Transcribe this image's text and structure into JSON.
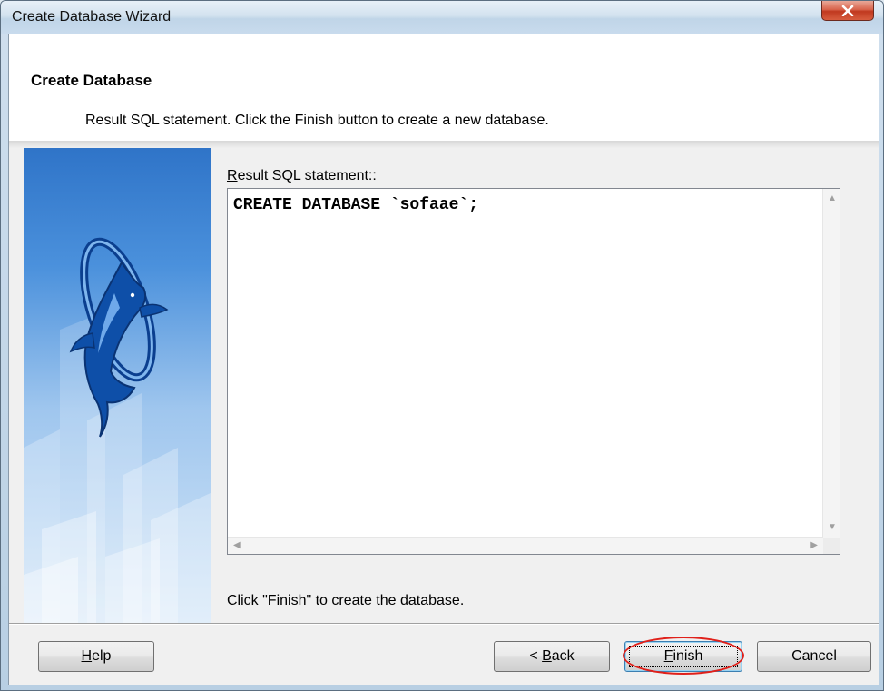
{
  "window": {
    "title": "Create Database Wizard",
    "close_label": "x"
  },
  "header": {
    "title": "Create Database",
    "subtitle": "Result SQL statement. Click the Finish button to create a new database."
  },
  "sql": {
    "label_mnemonic": "R",
    "label_rest": "esult SQL statement::",
    "statement": "CREATE DATABASE `sofaae`;"
  },
  "hint": "Click \"Finish\" to create the database.",
  "buttons": {
    "help": {
      "mnemonic": "H",
      "rest": "elp"
    },
    "back": {
      "prefix": "< ",
      "mnemonic": "B",
      "rest": "ack"
    },
    "finish": {
      "mnemonic": "F",
      "rest": "inish"
    },
    "cancel": {
      "label": "Cancel"
    }
  },
  "icons": {
    "close": "close-icon",
    "banner": "dolphin-logo-icon",
    "scroll_up": "scroll-up-arrow-icon",
    "scroll_down": "scroll-down-arrow-icon",
    "scroll_left": "scroll-left-arrow-icon",
    "scroll_right": "scroll-right-arrow-icon"
  },
  "colors": {
    "highlight": "#e0201a",
    "banner_top": "#2f74c8",
    "close_button": "#c0391f"
  }
}
